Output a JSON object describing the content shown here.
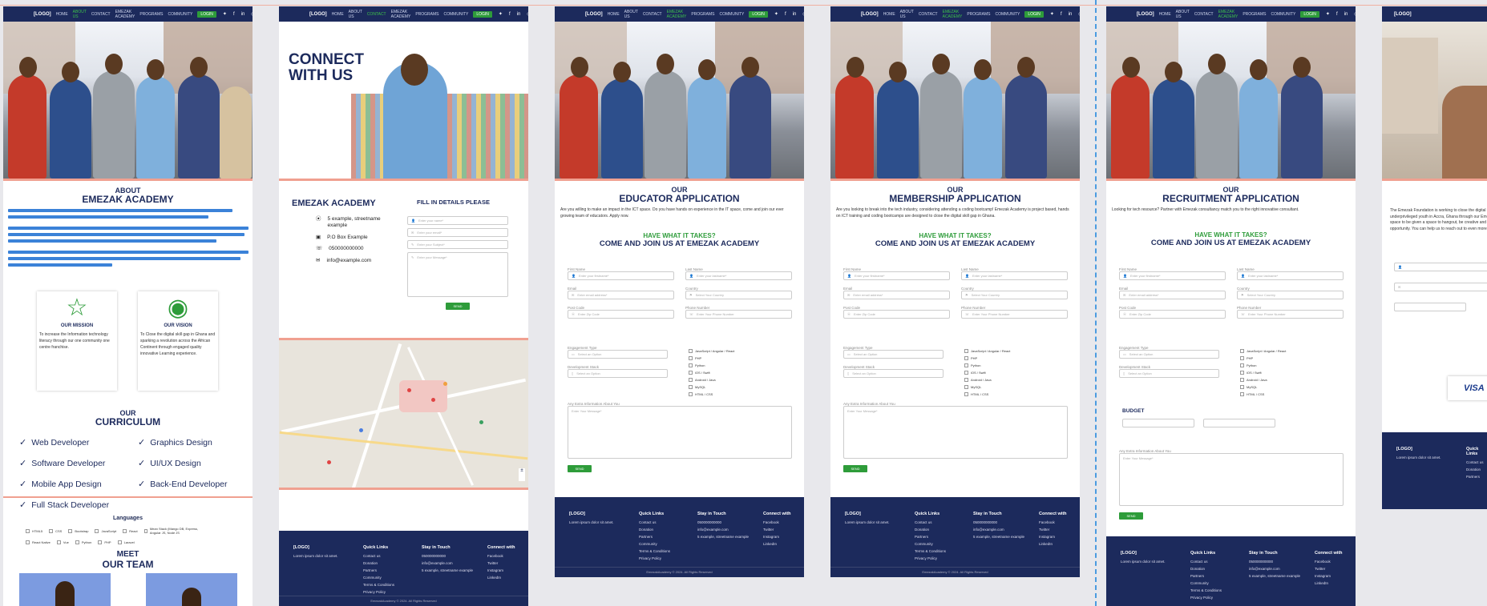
{
  "nav": {
    "logo": "[LOGO]",
    "links": [
      "HOME",
      "ABOUT US",
      "CONTACT",
      "EMEZAK ACADEMY",
      "PROGRAMS",
      "COMMUNITY"
    ],
    "login": "LOGIN"
  },
  "about": {
    "small": "ABOUT",
    "big": "EMEZAK ACADEMY",
    "mission_title": "OUR MISSION",
    "mission_text": "To increase the Information technology literacy through our one community one centre franchise.",
    "vision_title": "OUR VISION",
    "vision_text": "To Close the digital skill gap in Ghana and sparking a revolution across the African Continent through engaged quality innovative Learning experience."
  },
  "curriculum": {
    "small": "OUR",
    "big": "CURRICULUM",
    "items": [
      "Web Developer",
      "Graphics Design",
      "Software Developer",
      "UI/UX Design",
      "Mobile App Design",
      "Back-End Developer",
      "Full Stack Developer"
    ],
    "languages_title": "Languages",
    "languages": [
      "HTML5",
      "CSS",
      "Bootstrap",
      "JavaScript",
      "React",
      "Mean Stack (Mango DB, Express, Angular JS, Node JS",
      "React Native",
      "Vue",
      "Python",
      "PHP",
      "Laravel"
    ]
  },
  "team": {
    "small": "MEET",
    "big": "OUR TEAM"
  },
  "contact": {
    "hero_line1": "CONNECT",
    "hero_line2": "WITH US",
    "org": "EMEZAK ACADEMY",
    "address": "5 example, streetname example",
    "po": "P.O Box Example",
    "phone": "050000000000",
    "email": "info@example.com",
    "fill": "FILL IN DETAILS PLEASE",
    "placeholders": [
      "Enter your name*",
      "Enter your email*",
      "Enter your Subject*",
      "Enter your Message*"
    ],
    "send": "SEND"
  },
  "educator": {
    "small": "OUR",
    "big": "EDUCATOR APPLICATION",
    "intro": "Are you willing to make an impact in the ICT space. Do you have hands on experience in the IT space, come and join our ever growing team of educators. Apply now."
  },
  "membership": {
    "small": "OUR",
    "big": "MEMBERSHIP APPLICATION",
    "intro": "Are you looking to break into the tech industry, considering attending a coding bootcamp! Emezak Academy is project based, hands on ICT training and coding bootcamps are designed to close the digital skill gap in Ghana."
  },
  "recruitment": {
    "small": "OUR",
    "big": "RECRUITMENT APPLICATION",
    "intro": "Looking for tech resource? Partner with Emezak consultancy match you to the right innovative consultant.",
    "budget": "BUDGET"
  },
  "donate": {
    "intro": "The Emezak Foundation is working to close the digital divide for the underprivileged youth in Accra, Ghana through our Emezak Academy, a space to be given a space to hangout, be creative and rewarding opportunity. You can help us to reach out to even more of them.",
    "card": "VISA"
  },
  "form": {
    "have": "HAVE WHAT IT TAKES?",
    "join": "COME AND JOIN US AT EMEZAK ACADEMY",
    "labels": [
      "First Name",
      "Last Name",
      "Email",
      "Country",
      "Post Code",
      "Phone Number",
      "Engagement Type",
      "Development Stack",
      "Any Extra Information About You"
    ],
    "placeholders": [
      "Enter your firstname*",
      "Enter your lastname*",
      "Enter email address*",
      "Select Your Country",
      "Enter Zip Code",
      "Enter Your Phone Number",
      "Select an Option",
      "Select an Option",
      "Enter Your Message*"
    ],
    "stack": [
      "JavaScript / Angular / React",
      "PHP",
      "Python",
      "iOS / Swift",
      "Android / Java",
      "MySQL",
      "HTML / CSS"
    ],
    "send": "SEND"
  },
  "footer": {
    "logo": "[LOGO]",
    "tagline": "Lorem ipsum dolor sit amet.",
    "quick": "Quick Links",
    "quick_links": [
      "Contact us",
      "Donation",
      "Partners",
      "Community",
      "Terms & Conditions",
      "Privacy Policy"
    ],
    "stay": "Stay in Touch",
    "stay_items": [
      "050000000000",
      "info@example.com",
      "5 example, streetname example"
    ],
    "connect": "Connect with",
    "socials": [
      "Facebook",
      "Twitter",
      "Instagram",
      "LinkedIn"
    ],
    "copy": "EmezakAcademy © 2024. All Rights Reserved"
  },
  "colors": {
    "navy": "#1c2a5c",
    "green": "#2e9c3a",
    "accent": "#f0a090"
  }
}
